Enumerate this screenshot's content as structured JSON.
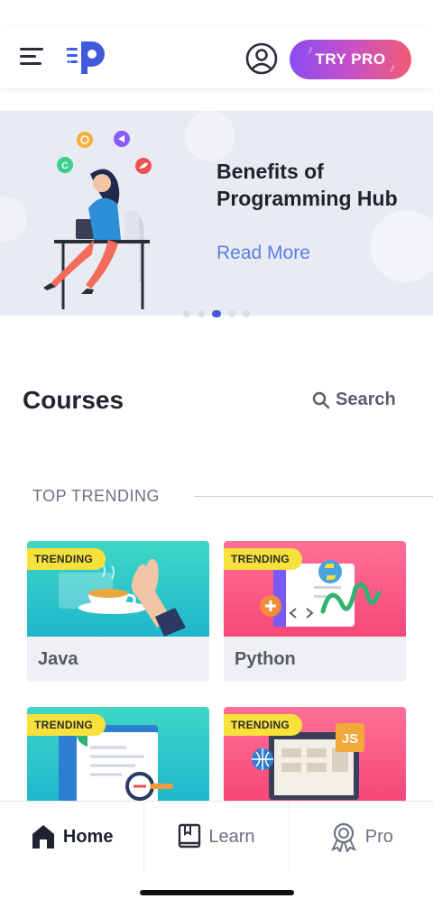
{
  "header": {
    "try_pro_label": "TRY PRO",
    "brand_color": "#3f5bdb"
  },
  "banner": {
    "title": "Benefits of Programming Hub",
    "link_label": "Read More",
    "carousel_total": 5,
    "carousel_active_index": 2,
    "illustration_badges": [
      "C",
      "Swift",
      "Kotlin",
      "Java"
    ]
  },
  "courses": {
    "title": "Courses",
    "search_label": "Search",
    "section_label": "TOP TRENDING",
    "cards": [
      {
        "badge": "TRENDING",
        "name": "Java",
        "theme": "teal"
      },
      {
        "badge": "TRENDING",
        "name": "Python",
        "theme": "pink"
      },
      {
        "badge": "TRENDING",
        "name": "",
        "theme": "teal"
      },
      {
        "badge": "TRENDING",
        "name": "",
        "theme": "pink"
      }
    ],
    "card4_tag": "JS"
  },
  "tabs": [
    {
      "label": "Home",
      "icon": "home-icon",
      "active": true
    },
    {
      "label": "Learn",
      "icon": "book-icon",
      "active": false
    },
    {
      "label": "Pro",
      "icon": "award-icon",
      "active": false
    }
  ],
  "colors": {
    "accent_blue": "#5b7ee6",
    "pro_gradient_start": "#8a4bf2",
    "pro_gradient_end": "#f15c72",
    "badge_yellow": "#f7e13a"
  }
}
